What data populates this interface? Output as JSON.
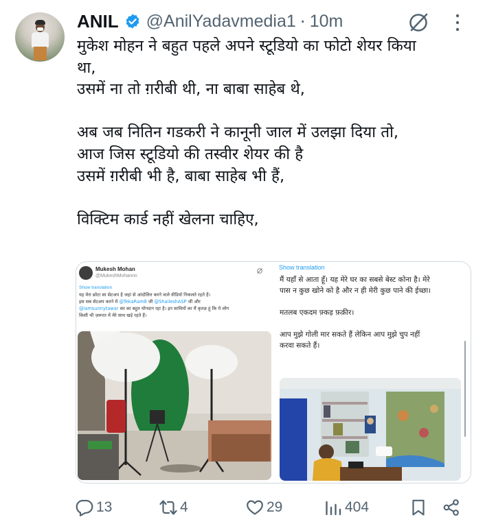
{
  "tweet": {
    "author_name": "ANIL",
    "handle": "@AnilYadavmedia1",
    "separator": "·",
    "time": "10m",
    "lines": [
      "मुकेश मोहन ने बहुत पहले अपने स्टूडियो का फोटो शेयर किया",
      "था,",
      "उसमें ना तो ग़रीबी थी, ना बाबा साहेब थे,",
      "",
      "अब जब नितिन गडकरी ने कानूनी जाल में उलझा दिया तो,",
      "आज जिस स्टूडियो की तस्वीर शेयर की है",
      "उसमें ग़रीबी भी है, बाबा साहेब भी हैं,",
      "",
      "विक्टिम कार्ड नहीं खेलना चाहिए,"
    ]
  },
  "media_left": {
    "name": "Mukesh Mohan",
    "handle": "@MukeshMohannn",
    "show_translation": "Show translation",
    "line1": "यह मेरा छोटा सा सेटअप है जहां से आंदोलित करने वाले वीडियो निकलते रहते हैं।",
    "line2_pre": "इस सब सेटअप करने में ",
    "mention1": "@TekaRam8",
    "line2_mid": " जी ",
    "mention2": "@ShaileshASP",
    "line2_post": " जी और",
    "mention3": "@iamsunnytawar",
    "line3_post": " सर का बहुत योगदान रहा है। इन साथियों का मैं कृतज्ञ हूं कि ये लोग",
    "line4": "किसी भी ज़रूरत में मेरे साथ खड़े रहते हैं।"
  },
  "media_right": {
    "show_translation": "Show translation",
    "lines": [
      "मैं यहाँ से आता हूँ। यह मेरे घर का सबसे बेस्ट कोना है। मेरे",
      "पास न कुछ खोने को है और न ही मेरी कुछ पाने की ईच्छा।",
      "",
      "मतलब एकदम फ़्कड़ फ़क़ीर।",
      "",
      "आप मुझे गोली मार सकते हैं लेकिन आप मुझे चुप नहीं",
      "करवा सकते हैं।"
    ]
  },
  "actions": {
    "replies": "13",
    "reposts": "4",
    "likes": "29",
    "views": "404"
  },
  "colors": {
    "text": "#0f1419",
    "secondary": "#536471",
    "verified": "#1d9bf0",
    "link": "#1d9bf0"
  },
  "icons": [
    "verified-badge-icon",
    "grok-icon",
    "more-options-icon",
    "reply-icon",
    "repost-icon",
    "like-icon",
    "views-icon",
    "bookmark-icon",
    "share-icon"
  ]
}
